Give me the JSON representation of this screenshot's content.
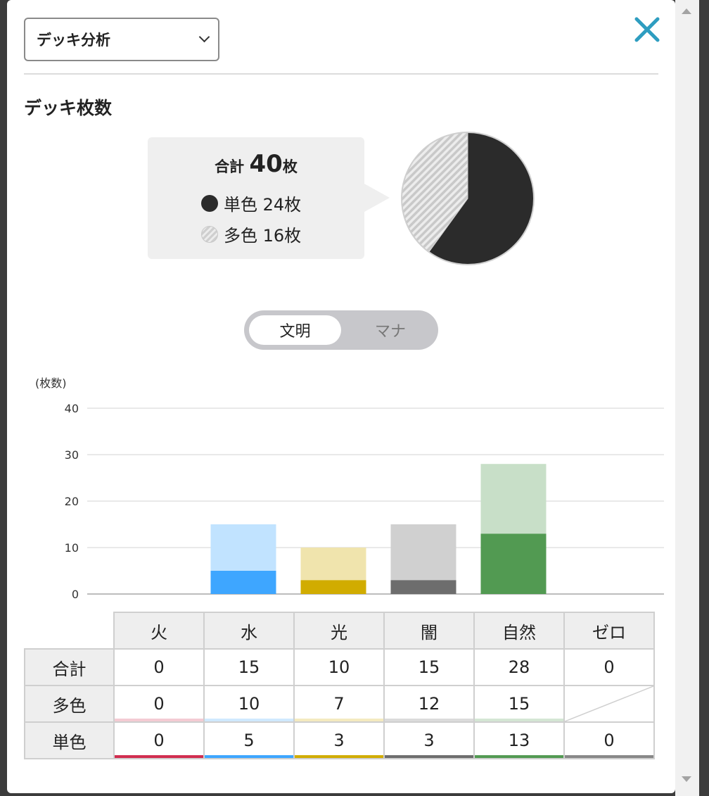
{
  "select": {
    "value": "デッキ分析"
  },
  "section_title": "デッキ枚数",
  "summary": {
    "total_prefix": "合計 ",
    "total_number": "40",
    "total_suffix": "枚",
    "mono_label": "単色 24枚",
    "multi_label": "多色 16枚"
  },
  "toggle": {
    "active": "文明",
    "inactive": "マナ"
  },
  "colors": {
    "fire": "#d12d4f",
    "water": "#3ea6ff",
    "light": "#d1ac00",
    "dark": "#6d6d6d",
    "nature": "#529a52",
    "zero": "#888888",
    "pie_mono": "#2b2b2b",
    "accent_close": "#2e9dc0"
  },
  "chart_data": {
    "type": "bar",
    "stacked": true,
    "ylabel": "(枚数)",
    "ylim": [
      0,
      40
    ],
    "yticks": [
      0,
      10,
      20,
      30,
      40
    ],
    "categories": [
      "火",
      "水",
      "光",
      "闇",
      "自然",
      "ゼロ"
    ],
    "series": [
      {
        "values": [
          0,
          5,
          3,
          3,
          13,
          0
        ]
      },
      {
        "values": [
          0,
          10,
          7,
          12,
          15,
          0
        ]
      }
    ],
    "grid": true
  },
  "pie_data": {
    "type": "pie",
    "slices": [
      {
        "label": "単色",
        "value": 24
      },
      {
        "label": "多色",
        "value": 16
      }
    ]
  },
  "table": {
    "columns": [
      "火",
      "水",
      "光",
      "闇",
      "自然",
      "ゼロ"
    ],
    "rows": [
      {
        "label": "合計",
        "cells": [
          "0",
          "15",
          "10",
          "15",
          "28",
          "0"
        ]
      },
      {
        "label": "多色",
        "cells": [
          "0",
          "10",
          "7",
          "12",
          "15",
          null
        ]
      },
      {
        "label": "単色",
        "cells": [
          "0",
          "5",
          "3",
          "3",
          "13",
          "0"
        ]
      }
    ]
  }
}
